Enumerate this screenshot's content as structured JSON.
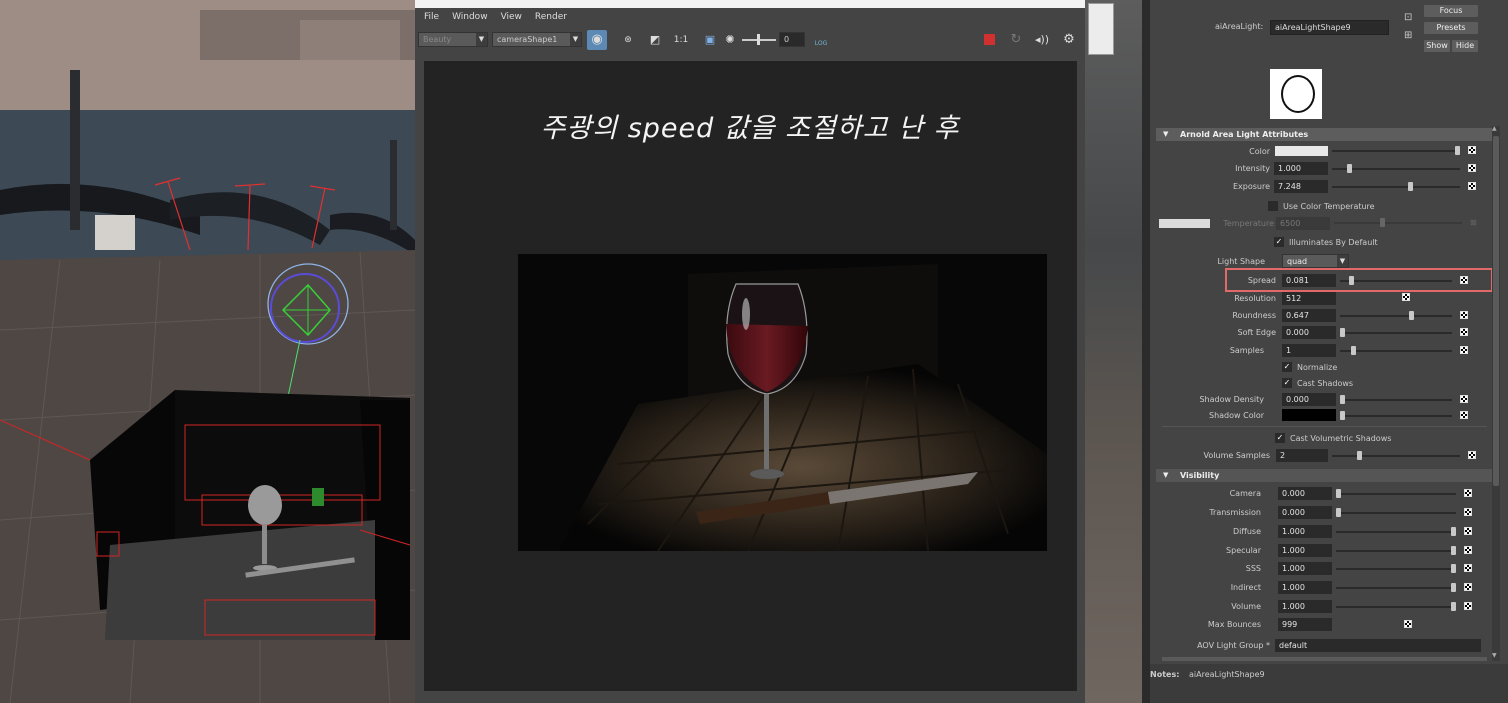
{
  "render_view": {
    "menu": [
      "File",
      "Window",
      "View",
      "Render"
    ],
    "layer_select": "Beauty",
    "camera_select": "cameraShape1",
    "ratio_label": "1:1",
    "exposure_value": "0",
    "log_label": "LOG",
    "caption": "주광의 speed 값을 조절하고 난 후"
  },
  "attribute_editor": {
    "node_label": "aiAreaLight:",
    "node_name": "aiAreaLightShape9",
    "focus_button": "Focus",
    "presets_button": "Presets",
    "show_button": "Show",
    "hide_button": "Hide",
    "section_arnold": "Arnold Area Light Attributes",
    "section_visibility": "Visibility",
    "color_label": "Color",
    "intensity_label": "Intensity",
    "intensity_value": "1.000",
    "exposure_label": "Exposure",
    "exposure_value": "7.248",
    "use_color_temp_label": "Use Color Temperature",
    "temperature_label": "Temperature",
    "temperature_value": "6500",
    "illuminates_label": "Illuminates By Default",
    "light_shape_label": "Light Shape",
    "light_shape_value": "quad",
    "spread_label": "Spread",
    "spread_value": "0.081",
    "resolution_label": "Resolution",
    "resolution_value": "512",
    "roundness_label": "Roundness",
    "roundness_value": "0.647",
    "soft_edge_label": "Soft Edge",
    "soft_edge_value": "0.000",
    "samples_label": "Samples",
    "samples_value": "1",
    "normalize_label": "Normalize",
    "cast_shadows_label": "Cast Shadows",
    "shadow_density_label": "Shadow Density",
    "shadow_density_value": "0.000",
    "shadow_color_label": "Shadow Color",
    "cast_volumetric_label": "Cast Volumetric Shadows",
    "volume_samples_label": "Volume Samples",
    "volume_samples_value": "2",
    "camera_label": "Camera",
    "camera_value": "0.000",
    "transmission_label": "Transmission",
    "transmission_value": "0.000",
    "diffuse_label": "Diffuse",
    "diffuse_value": "1.000",
    "specular_label": "Specular",
    "specular_value": "1.000",
    "sss_label": "SSS",
    "sss_value": "1.000",
    "indirect_label": "Indirect",
    "indirect_value": "1.000",
    "volume_label": "Volume",
    "volume_value": "1.000",
    "max_bounces_label": "Max Bounces",
    "max_bounces_value": "999",
    "aov_label": "AOV Light Group *",
    "aov_value": "default",
    "notes_label": "Notes:",
    "notes_value": "aiAreaLightShape9",
    "slider_levels": {
      "intensity": 0.12,
      "exposure": 0.62,
      "spread": 0.08,
      "roundness": 0.647,
      "soft_edge": 0.0,
      "samples": 0.1,
      "shadow_density": 0.0,
      "volume_samples": 0.2,
      "camera": 0.0,
      "transmission": 0.0,
      "diffuse": 1.0,
      "specular": 1.0,
      "sss": 1.0,
      "indirect": 1.0,
      "volume": 1.0
    }
  },
  "colors": {
    "highlight": "#e06a6a",
    "accent": "#5c8ab5",
    "stop_button": "#d03030"
  }
}
